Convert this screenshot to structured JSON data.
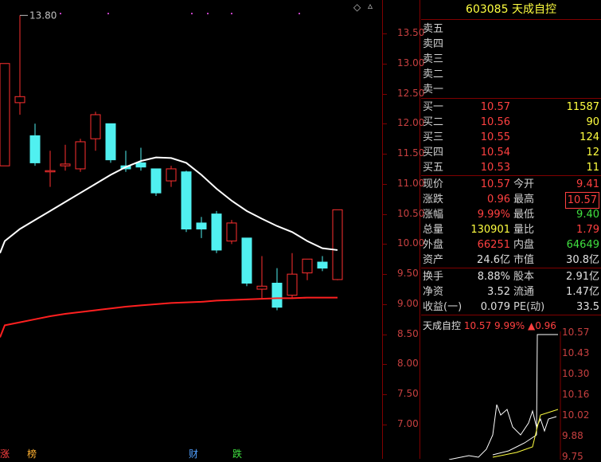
{
  "chart": {
    "ylim": [
      6.6,
      13.85
    ],
    "price_labels": [
      "13.50",
      "13.00",
      "12.50",
      "12.00",
      "11.50",
      "11.00",
      "10.50",
      "10.00",
      "9.50",
      "9.00",
      "8.50",
      "8.00",
      "7.50",
      "7.00"
    ],
    "high_marker": "13.80",
    "up_color": "#ff3030",
    "down_color": "#50f0f0",
    "ma_short_color": "#ffffff",
    "ma_long_color": "#ff2020",
    "candles": [
      {
        "o": 11.3,
        "c": 13.0,
        "h": 13.0,
        "l": 11.3
      },
      {
        "o": 12.35,
        "c": 12.45,
        "h": 13.8,
        "l": 12.15
      },
      {
        "o": 11.8,
        "c": 11.35,
        "h": 12.0,
        "l": 11.3
      },
      {
        "o": 11.2,
        "c": 11.22,
        "h": 11.55,
        "l": 10.95
      },
      {
        "o": 11.3,
        "c": 11.33,
        "h": 11.65,
        "l": 11.22
      },
      {
        "o": 11.25,
        "c": 11.7,
        "h": 11.75,
        "l": 11.2
      },
      {
        "o": 11.75,
        "c": 12.15,
        "h": 12.2,
        "l": 11.55
      },
      {
        "o": 12.0,
        "c": 11.4,
        "h": 12.0,
        "l": 11.35
      },
      {
        "o": 11.3,
        "c": 11.25,
        "h": 11.55,
        "l": 11.2
      },
      {
        "o": 11.35,
        "c": 11.28,
        "h": 11.6,
        "l": 11.22
      },
      {
        "o": 11.25,
        "c": 10.85,
        "h": 11.25,
        "l": 10.8
      },
      {
        "o": 11.05,
        "c": 11.25,
        "h": 11.3,
        "l": 10.95
      },
      {
        "o": 11.2,
        "c": 10.25,
        "h": 11.22,
        "l": 10.2
      },
      {
        "o": 10.35,
        "c": 10.25,
        "h": 10.45,
        "l": 10.1
      },
      {
        "o": 10.5,
        "c": 9.9,
        "h": 10.55,
        "l": 9.85
      },
      {
        "o": 10.05,
        "c": 10.35,
        "h": 10.4,
        "l": 10.0
      },
      {
        "o": 10.1,
        "c": 9.35,
        "h": 10.1,
        "l": 9.3
      },
      {
        "o": 9.25,
        "c": 9.3,
        "h": 9.8,
        "l": 9.1
      },
      {
        "o": 9.35,
        "c": 8.95,
        "h": 9.6,
        "l": 8.9
      },
      {
        "o": 9.15,
        "c": 9.5,
        "h": 9.85,
        "l": 9.1
      },
      {
        "o": 9.52,
        "c": 9.75,
        "h": 9.75,
        "l": 9.4
      },
      {
        "o": 9.7,
        "c": 9.6,
        "h": 9.8,
        "l": 9.55
      },
      {
        "o": 9.41,
        "c": 10.57,
        "h": 10.57,
        "l": 9.4
      }
    ],
    "ma_short": [
      10.05,
      10.25,
      10.4,
      10.55,
      10.7,
      10.85,
      11.0,
      11.15,
      11.28,
      11.38,
      11.44,
      11.43,
      11.35,
      11.15,
      10.92,
      10.72,
      10.55,
      10.42,
      10.3,
      10.2,
      10.05,
      9.93,
      9.9
    ],
    "ma_long": [
      8.65,
      8.7,
      8.75,
      8.8,
      8.84,
      8.87,
      8.9,
      8.93,
      8.96,
      8.98,
      9.0,
      9.02,
      9.03,
      9.04,
      9.06,
      9.07,
      9.08,
      9.09,
      9.1,
      9.1,
      9.11,
      9.11,
      9.11
    ],
    "bottom_marks": [
      {
        "label": "涨",
        "color": "#ff4040"
      },
      {
        "label": "榜",
        "color": "#ffb030"
      },
      {
        "label": "财",
        "color": "#50a0ff"
      },
      {
        "label": "跌",
        "color": "#40e040"
      }
    ]
  },
  "quote": {
    "code": "603085",
    "name": "天成自控",
    "asks": [
      {
        "label": "卖五",
        "price": "",
        "vol": ""
      },
      {
        "label": "卖四",
        "price": "",
        "vol": ""
      },
      {
        "label": "卖三",
        "price": "",
        "vol": ""
      },
      {
        "label": "卖二",
        "price": "",
        "vol": ""
      },
      {
        "label": "卖一",
        "price": "",
        "vol": ""
      }
    ],
    "bids": [
      {
        "label": "买一",
        "price": "10.57",
        "vol": "11587"
      },
      {
        "label": "买二",
        "price": "10.56",
        "vol": "90"
      },
      {
        "label": "买三",
        "price": "10.55",
        "vol": "124"
      },
      {
        "label": "买四",
        "price": "10.54",
        "vol": "12"
      },
      {
        "label": "买五",
        "price": "10.53",
        "vol": "11"
      }
    ],
    "stats": [
      {
        "l1": "现价",
        "v1": "10.57",
        "c1": "red",
        "l2": "今开",
        "v2": "9.41",
        "c2": "red"
      },
      {
        "l1": "涨跌",
        "v1": "0.96",
        "c1": "red",
        "l2": "最高",
        "v2": "10.57",
        "c2": "red boxed"
      },
      {
        "l1": "涨幅",
        "v1": "9.99%",
        "c1": "red",
        "l2": "最低",
        "v2": "9.40",
        "c2": "green"
      },
      {
        "l1": "总量",
        "v1": "130901",
        "c1": "yellow",
        "l2": "量比",
        "v2": "1.79",
        "c2": "red"
      },
      {
        "l1": "外盘",
        "v1": "66251",
        "c1": "red",
        "l2": "内盘",
        "v2": "64649",
        "c2": "green"
      },
      {
        "l1": "资产",
        "v1": "24.6亿",
        "c1": "white",
        "l2": "市值",
        "v2": "30.8亿",
        "c2": "white"
      }
    ],
    "stats2": [
      {
        "l1": "换手",
        "v1": "8.88%",
        "c1": "white",
        "l2": "股本",
        "v2": "2.91亿",
        "c2": "white"
      },
      {
        "l1": "净资",
        "v1": "3.52",
        "c1": "white",
        "l2": "流通",
        "v2": "1.47亿",
        "c2": "white"
      },
      {
        "l1": "收益(一)",
        "v1": "0.079",
        "c1": "white",
        "l2": "PE(动)",
        "v2": "33.5",
        "c2": "white"
      }
    ]
  },
  "mini": {
    "name": "天成自控",
    "price": "10.57",
    "pct": "9.99%",
    "change": "▲0.96",
    "axis": [
      "10.57",
      "10.43",
      "10.30",
      "10.16",
      "10.02",
      "9.88",
      "9.75"
    ]
  }
}
